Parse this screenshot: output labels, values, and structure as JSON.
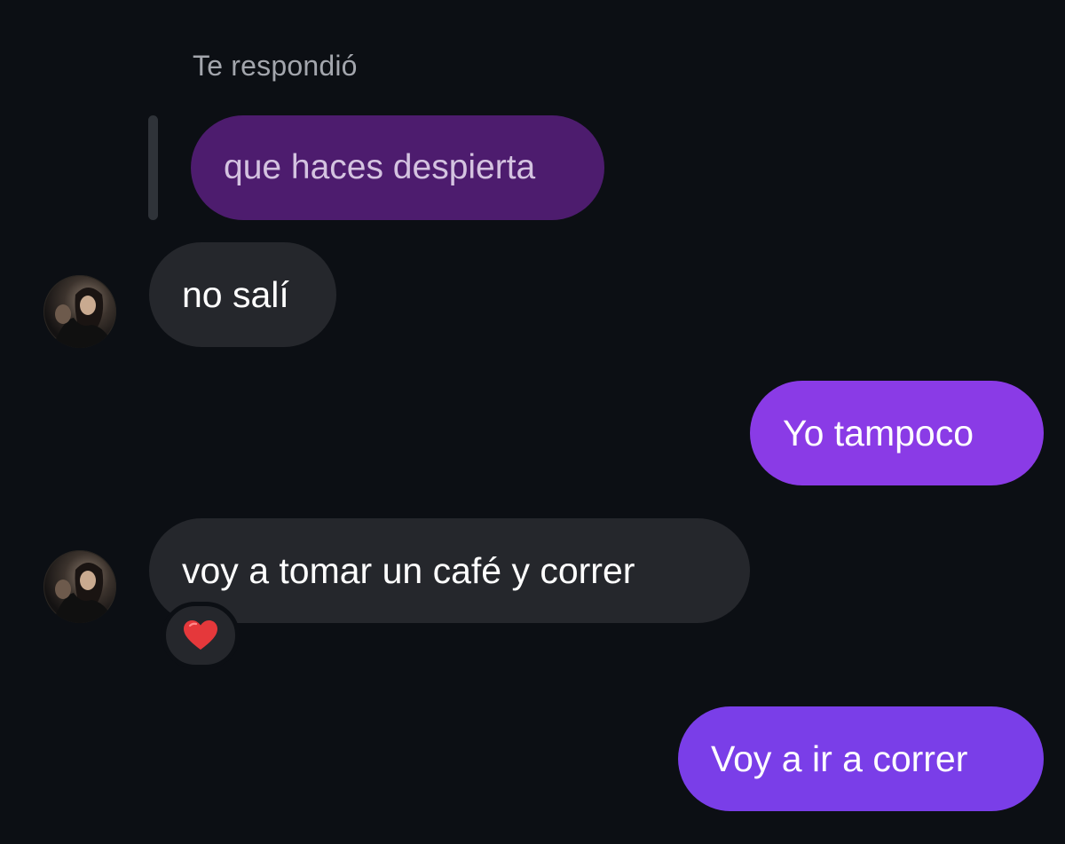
{
  "reply_context": {
    "label": "Te respondió",
    "quoted_message": "que haces despierta"
  },
  "messages": [
    {
      "direction": "incoming",
      "text": "no salí",
      "avatar_icon": "contact-avatar"
    },
    {
      "direction": "outgoing",
      "text": "Yo tampoco"
    },
    {
      "direction": "incoming",
      "text": "voy a tomar un café y correr",
      "avatar_icon": "contact-avatar",
      "reaction_icon": "red-heart-icon"
    },
    {
      "direction": "outgoing",
      "text": "Voy a ir a correr"
    }
  ],
  "colors": {
    "background": "#0c0f14",
    "incoming_bubble": "#25272c",
    "outgoing_bubble": "#8a3be6",
    "quoted_bubble": "#4d1c6e",
    "reaction_heart": "#e5383b"
  }
}
